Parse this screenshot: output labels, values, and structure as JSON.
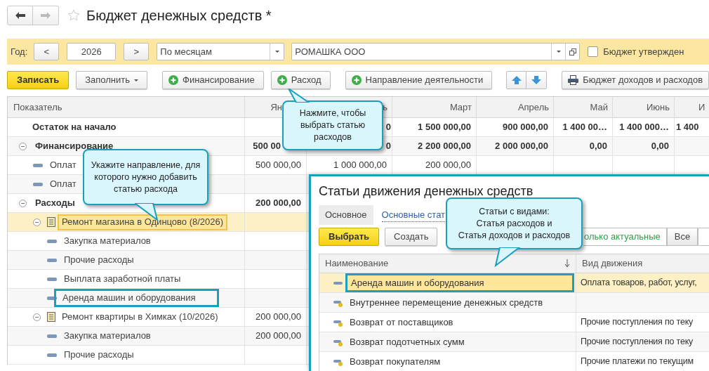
{
  "window": {
    "title": "Бюджет денежных средств *"
  },
  "filters": {
    "year_label": "Год:",
    "prev": "<",
    "year": "2026",
    "next": ">",
    "period": "По месяцам",
    "organization": "РОМАШКА ООО",
    "approved": {
      "label": "Бюджет утвержден",
      "checked": false
    }
  },
  "toolbar": [
    {
      "kind": "primary",
      "label": "Записать"
    },
    {
      "kind": "menu",
      "label": "Заполнить"
    },
    {
      "kind": "add",
      "label": "Финансирование"
    },
    {
      "kind": "add",
      "label": "Расход"
    },
    {
      "kind": "add",
      "label": "Направление деятельности"
    },
    {
      "kind": "arrows"
    },
    {
      "kind": "print",
      "label": "Бюджет доходов и расходов"
    }
  ],
  "table": {
    "columns": [
      "Показатель",
      "Ян",
      "ь",
      "Март",
      "Апрель",
      "Май",
      "Июнь",
      "И"
    ],
    "rows": [
      {
        "kind": "total",
        "label": "Остаток на начало",
        "selected": false,
        "values": {
          "column_2": "0",
          "column_3": "1 500 000,00",
          "column_4": "900 000,00",
          "column_5": "1 400 00…",
          "column_6": "1 400 000…",
          "column_7": "1 400"
        }
      },
      {
        "kind": "group",
        "label": "Финансирование",
        "expanded": true,
        "selected": false,
        "values": {
          "column_1": "500 00",
          "column_2": "0",
          "column_3": "2 200 000,00",
          "column_4": "2 000 000,00",
          "column_5": "0,00",
          "column_6": "0,00"
        },
        "children": [
          {
            "kind": "item",
            "label": "Оплат",
            "selected": false,
            "values": {
              "column_1": "500 000,00",
              "column_2": "1 000 000,00",
              "column_3": "200 000,00"
            }
          },
          {
            "kind": "item",
            "label": "Оплат",
            "selected": false
          }
        ]
      },
      {
        "kind": "group",
        "label": "Расходы",
        "expanded": true,
        "selected": false,
        "values": {
          "column_1": "200 000,00"
        },
        "children": [
          {
            "kind": "direction",
            "label": "Ремонт магазина в Одинцово (8/2026)",
            "expanded": true,
            "selected": true,
            "children": [
              {
                "kind": "item",
                "label": "Закупка материалов",
                "selected": false
              },
              {
                "kind": "item",
                "label": "Прочие расходы",
                "selected": false
              },
              {
                "kind": "item",
                "label": "Выплата заработной платы",
                "selected": false
              },
              {
                "kind": "item",
                "label": "Аренда машин и оборудования",
                "selected": false,
                "framed": true
              }
            ]
          },
          {
            "kind": "direction",
            "label": "Ремонт квартиры в Химках (10/2026)",
            "expanded": true,
            "selected": false,
            "values": {
              "column_1": "200 000,00"
            },
            "children": [
              {
                "kind": "item",
                "label": "Закупка материалов",
                "selected": false,
                "values": {
                  "column_1": "200 000,00"
                }
              },
              {
                "kind": "item",
                "label": "Прочие расходы",
                "selected": false
              }
            ]
          }
        ]
      }
    ]
  },
  "popup": {
    "title": "Статьи движения денежных средств",
    "tabs": [
      {
        "label": "Основное",
        "selected": true
      },
      {
        "label": "Основные стат",
        "selected": false
      }
    ],
    "buttons": [
      {
        "kind": "primary",
        "label": "Выбрать"
      },
      {
        "kind": "default",
        "label": "Создать"
      }
    ],
    "filter": [
      {
        "label": "олько актуальные",
        "selected": true
      },
      {
        "label": "Все",
        "selected": false
      }
    ],
    "table": {
      "columns": [
        "Наименование",
        "Вид движения"
      ],
      "rows": [
        {
          "kind": "plain",
          "name": "Аренда машин и оборудования",
          "movement": "Оплата товаров, работ, услуг,",
          "selected": true,
          "framed": true
        },
        {
          "kind": "marked",
          "name": "Внутреннее перемещение денежных средств",
          "selected": false
        },
        {
          "kind": "marked",
          "name": "Возврат от поставщиков",
          "movement": "Прочие поступления по теку",
          "selected": false
        },
        {
          "kind": "marked",
          "name": "Возврат подотчетных сумм",
          "movement": "Прочие поступления по теку",
          "selected": false
        },
        {
          "kind": "marked",
          "name": "Возврат покупателям",
          "movement": "Прочие платежи по текущим",
          "selected": false
        }
      ]
    }
  },
  "callouts": [
    {
      "text": "Нажмите, чтобы выбрать статью расходов"
    },
    {
      "text": "Укажите направление, для которого нужно добавить статью расхода"
    },
    {
      "text": "Статьи с видами:\nСтатья расходов и\nСтатья доходов и расходов"
    }
  ]
}
